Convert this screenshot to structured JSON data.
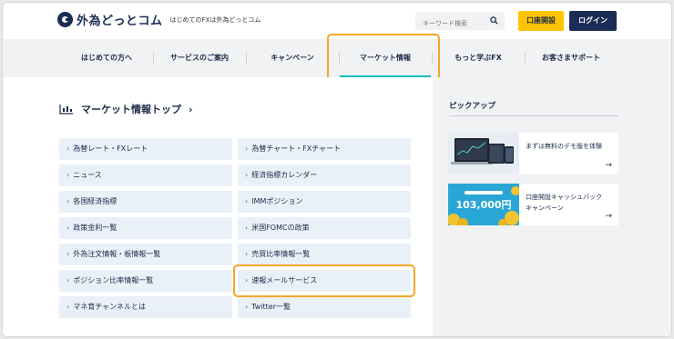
{
  "header": {
    "logo_text": "外為どっとコム",
    "tagline": "はじめてのFXは外為どっとコム",
    "search_placeholder": "キーワード検索",
    "open_account_label": "口座開設",
    "login_label": "ログイン"
  },
  "nav": {
    "items": [
      {
        "label": "はじめての方へ"
      },
      {
        "label": "サービスのご案内"
      },
      {
        "label": "キャンペーン"
      },
      {
        "label": "マーケット情報"
      },
      {
        "label": "もっと学ぶFX"
      },
      {
        "label": "お客さまサポート"
      }
    ],
    "active_index": 3
  },
  "main": {
    "title": "マーケット情報トップ",
    "links": [
      {
        "label": "為替レート・FXレート"
      },
      {
        "label": "為替チャート・FXチャート"
      },
      {
        "label": "ニュース"
      },
      {
        "label": "経済指標カレンダー"
      },
      {
        "label": "各国経済指標"
      },
      {
        "label": "IMMポジション"
      },
      {
        "label": "政策金利一覧"
      },
      {
        "label": "米国FOMCの政策"
      },
      {
        "label": "外為注文情報・板情報一覧"
      },
      {
        "label": "売買比率情報一覧"
      },
      {
        "label": "ポジション比率情報一覧"
      },
      {
        "label": "速報メールサービス"
      },
      {
        "label": "マネ育チャンネルとは"
      },
      {
        "label": "Twitter一覧"
      }
    ]
  },
  "sidebar": {
    "title": "ピックアップ",
    "cards": [
      {
        "text": "まずは無料のデモ版を体験"
      },
      {
        "text": "口座開設キャッシュバックキャンペーン",
        "image_text": "103,000円"
      }
    ]
  },
  "colors": {
    "navy": "#1b2d55",
    "yellow": "#ffc400",
    "highlight": "#f5a623",
    "active_bar": "#00bbbb"
  }
}
